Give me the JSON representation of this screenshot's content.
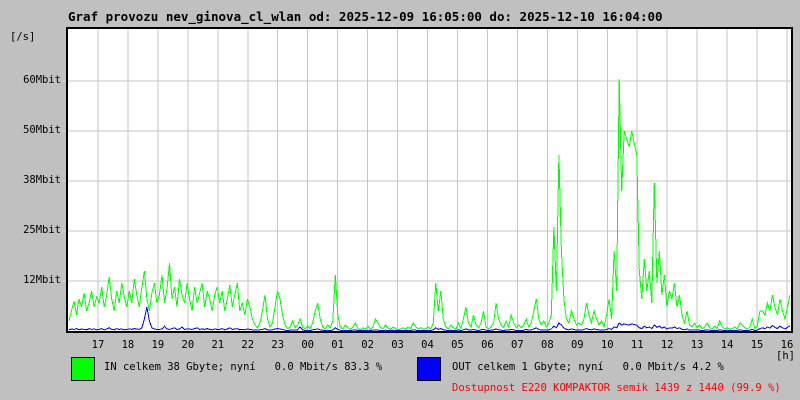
{
  "title": "Graf provozu nev_ginova_cl_wlan od: 2025-12-09 16:05:00 do: 2025-12-10 16:04:00",
  "unit_label": "[/s]",
  "hours_label": "[h]",
  "colors": {
    "background": "#c0c0c0",
    "plot_background": "#ffffff",
    "grid": "#c6c6c6",
    "axis": "#000000",
    "in_series": "#00ff00",
    "out_series": "#0000ff",
    "availability_text": "#ff0000"
  },
  "legend": {
    "in": {
      "label": "IN celkem 38 Gbyte; nyní   0.0 Mbit/s 83.3 %",
      "color": "#00ff00"
    },
    "out": {
      "label": "OUT celkem 1 Gbyte; nyní   0.0 Mbit/s 4.2 %",
      "color": "#0000ff"
    }
  },
  "availability": {
    "text": "Dostupnost E220 KOMPAKTOR semik 1439 z 1440 (99.9 %)",
    "color": "#ff0000"
  },
  "chart_data": {
    "type": "line",
    "title": "Graf provozu nev_ginova_cl_wlan od: 2025-12-09 16:05:00 do: 2025-12-10 16:04:00",
    "ylabel": "[/s]",
    "xlabel": "[h]",
    "grid": true,
    "legend_position": "bottom",
    "time_start": "2025-12-09 16:05:00",
    "time_end": "2025-12-10 16:04:00",
    "interval_minutes": 5,
    "ylim": [
      0,
      75.5
    ],
    "y_ticks": [
      {
        "value": 12.5,
        "label": "12Mbit"
      },
      {
        "value": 25,
        "label": "25Mbit"
      },
      {
        "value": 37.5,
        "label": "38Mbit"
      },
      {
        "value": 50,
        "label": "50Mbit"
      },
      {
        "value": 62.5,
        "label": "60Mbit"
      }
    ],
    "x_ticks": [
      {
        "hour": 1,
        "label": "17"
      },
      {
        "hour": 2,
        "label": "18"
      },
      {
        "hour": 3,
        "label": "19"
      },
      {
        "hour": 4,
        "label": "20"
      },
      {
        "hour": 5,
        "label": "21"
      },
      {
        "hour": 6,
        "label": "22"
      },
      {
        "hour": 7,
        "label": "23"
      },
      {
        "hour": 8,
        "label": "00"
      },
      {
        "hour": 9,
        "label": "01"
      },
      {
        "hour": 10,
        "label": "02"
      },
      {
        "hour": 11,
        "label": "03"
      },
      {
        "hour": 12,
        "label": "04"
      },
      {
        "hour": 13,
        "label": "05"
      },
      {
        "hour": 14,
        "label": "06"
      },
      {
        "hour": 15,
        "label": "07"
      },
      {
        "hour": 16,
        "label": "08"
      },
      {
        "hour": 17,
        "label": "09"
      },
      {
        "hour": 18,
        "label": "10"
      },
      {
        "hour": 19,
        "label": "11"
      },
      {
        "hour": 20,
        "label": "12"
      },
      {
        "hour": 21,
        "label": "13"
      },
      {
        "hour": 22,
        "label": "14"
      },
      {
        "hour": 23,
        "label": "15"
      },
      {
        "hour": 24,
        "label": "16"
      }
    ],
    "series": [
      {
        "name": "IN",
        "color": "#00ff00",
        "unit": "Mbit/s",
        "values": [
          2.5,
          5,
          7.5,
          4,
          8,
          6,
          9.5,
          5,
          7,
          10,
          6,
          8.5,
          7,
          11,
          6,
          9,
          13.5,
          8,
          5,
          10,
          7,
          12,
          8.5,
          6,
          10,
          7,
          13,
          9,
          6,
          11,
          15,
          8,
          5,
          9.5,
          12,
          7,
          9,
          14,
          7,
          10.5,
          17,
          8,
          11,
          6,
          13,
          9,
          7,
          12,
          8,
          5,
          11,
          7,
          9.5,
          12,
          6,
          10,
          8,
          5,
          9,
          11,
          7,
          10,
          5,
          8,
          11.5,
          6,
          9,
          12,
          5,
          7,
          4,
          8,
          6,
          3,
          1.5,
          0.8,
          2,
          5,
          9,
          3,
          1,
          2,
          6,
          10,
          8,
          4,
          1.5,
          0.6,
          1,
          2.5,
          0.8,
          1.5,
          3,
          1,
          0.5,
          1.2,
          0.6,
          2,
          5,
          7,
          3,
          1,
          0.5,
          1.5,
          0.8,
          2.5,
          14,
          4,
          1,
          0.5,
          1.5,
          0.8,
          0.4,
          1,
          2,
          0.6,
          0.3,
          0.8,
          0.5,
          1.2,
          0.4,
          1,
          3,
          2,
          0.8,
          0.5,
          1.5,
          0.7,
          0.4,
          1,
          0.6,
          0.3,
          0.5,
          0.8,
          0.4,
          1,
          0.6,
          2,
          1,
          0.5,
          0.8,
          0.4,
          0.6,
          1,
          0.5,
          2,
          12,
          5,
          10,
          3,
          1,
          0.5,
          1.5,
          0.8,
          0.4,
          2,
          0.6,
          3,
          6,
          2,
          1,
          4,
          1.5,
          0.8,
          2,
          5,
          1,
          0.5,
          1,
          2,
          7,
          3,
          1.5,
          0.8,
          2.5,
          1,
          4,
          2,
          0.8,
          1.5,
          0.8,
          1.5,
          3,
          1,
          2,
          5,
          8,
          3,
          1.5,
          2.5,
          1,
          2,
          4,
          26,
          10,
          44,
          20,
          8,
          3,
          2,
          5,
          3,
          1.5,
          2,
          1.5,
          3,
          7,
          4,
          2,
          5,
          3,
          1.5,
          2.5,
          1,
          4,
          8,
          3,
          20,
          10,
          63,
          35,
          50,
          48,
          46,
          50,
          47,
          44,
          15,
          8,
          18,
          10,
          15,
          7,
          37,
          12,
          20,
          9,
          14,
          6,
          10,
          8,
          12,
          6,
          9,
          4,
          2,
          5,
          1.5,
          1,
          2,
          0.8,
          1.5,
          0.6,
          1,
          2,
          0.8,
          0.5,
          1.2,
          0.6,
          2.5,
          1,
          0.5,
          0.8,
          0.4,
          0.6,
          1,
          0.5,
          2,
          1.5,
          0.8,
          0.4,
          1,
          3,
          0.6,
          1.2,
          5,
          5,
          4,
          7,
          5,
          9,
          6,
          4,
          8,
          5,
          3,
          6,
          9
        ]
      },
      {
        "name": "OUT",
        "color": "#0000ff",
        "unit": "Mbit/s",
        "values": [
          0.3,
          0.5,
          0.4,
          0.6,
          0.3,
          0.5,
          0.4,
          0.3,
          0.6,
          0.4,
          0.5,
          0.3,
          0.4,
          0.6,
          0.3,
          0.5,
          0.8,
          0.4,
          0.3,
          0.6,
          0.4,
          0.5,
          0.3,
          0.4,
          0.5,
          0.4,
          0.6,
          0.5,
          0.4,
          0.8,
          3,
          6,
          2.5,
          0.8,
          0.5,
          0.4,
          0.4,
          0.5,
          1.2,
          0.5,
          0.4,
          0.6,
          0.8,
          0.4,
          0.5,
          1,
          0.4,
          0.5,
          0.5,
          0.4,
          0.6,
          0.8,
          0.4,
          0.5,
          0.4,
          0.6,
          0.4,
          0.3,
          0.5,
          0.4,
          0.4,
          0.6,
          0.3,
          0.5,
          0.8,
          0.4,
          0.5,
          0.6,
          0.3,
          0.4,
          0.3,
          0.5,
          0.4,
          0.3,
          0.2,
          0.2,
          0.3,
          0.4,
          0.6,
          0.3,
          0.2,
          0.3,
          0.5,
          0.6,
          0.5,
          0.4,
          0.2,
          0.1,
          0.2,
          0.3,
          0.2,
          0.3,
          1,
          0.3,
          0.1,
          0.2,
          0.1,
          0.3,
          0.4,
          0.5,
          0.3,
          0.2,
          0.1,
          0.2,
          0.1,
          0.3,
          0.8,
          0.4,
          0.2,
          0.1,
          0.2,
          0.1,
          0.1,
          0.2,
          0.3,
          0.1,
          0.1,
          0.2,
          0.1,
          0.2,
          0.1,
          0.2,
          0.3,
          0.2,
          0.1,
          0.1,
          0.2,
          0.1,
          0.1,
          0.2,
          0.1,
          0.1,
          0.1,
          0.1,
          0.1,
          0.2,
          0.1,
          0.3,
          0.2,
          0.1,
          0.1,
          0.1,
          0.1,
          0.2,
          0.1,
          0.3,
          0.8,
          0.4,
          0.6,
          0.3,
          0.2,
          0.1,
          0.2,
          0.1,
          0.1,
          0.3,
          0.1,
          0.3,
          0.5,
          0.3,
          0.2,
          0.4,
          0.2,
          0.1,
          0.3,
          0.4,
          0.2,
          0.1,
          0.2,
          0.3,
          0.5,
          0.3,
          0.2,
          0.1,
          0.3,
          0.2,
          0.4,
          0.3,
          0.1,
          0.2,
          0.1,
          0.2,
          0.4,
          0.2,
          0.3,
          0.5,
          0.8,
          0.4,
          0.2,
          0.3,
          0.2,
          0.3,
          0.5,
          1.2,
          0.8,
          2,
          1.5,
          0.8,
          0.4,
          0.3,
          0.5,
          0.4,
          0.2,
          0.3,
          0.2,
          0.4,
          0.6,
          0.4,
          0.3,
          0.5,
          0.4,
          0.2,
          0.3,
          0.2,
          0.4,
          0.6,
          0.4,
          1,
          0.8,
          2,
          1.5,
          1.8,
          1.6,
          1.5,
          1.8,
          1.6,
          1.5,
          0.8,
          0.6,
          1.2,
          0.8,
          1,
          0.6,
          1.5,
          0.9,
          1.2,
          0.7,
          1,
          0.5,
          0.8,
          0.7,
          1,
          0.6,
          0.8,
          0.4,
          0.3,
          0.5,
          0.2,
          0.2,
          0.3,
          0.2,
          0.2,
          0.1,
          0.2,
          0.3,
          0.2,
          0.1,
          0.2,
          0.1,
          0.3,
          0.2,
          0.1,
          0.2,
          0.1,
          0.1,
          0.2,
          0.1,
          0.3,
          0.2,
          0.1,
          0.1,
          0.2,
          0.4,
          0.1,
          0.2,
          0.6,
          0.8,
          0.6,
          1,
          0.7,
          1.4,
          0.9,
          0.6,
          1.2,
          0.8,
          0.5,
          0.9,
          1.3
        ]
      }
    ]
  }
}
